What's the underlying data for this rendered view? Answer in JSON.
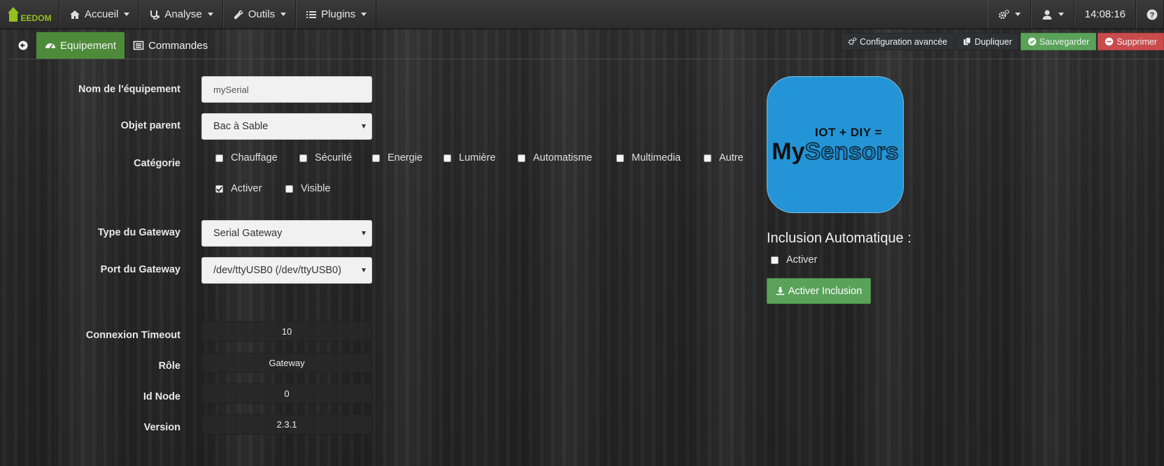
{
  "brand": {
    "text": "EEDOM"
  },
  "nav": {
    "items": [
      {
        "label": "Accueil",
        "icon": "home-icon"
      },
      {
        "label": "Analyse",
        "icon": "stethoscope-icon"
      },
      {
        "label": "Outils",
        "icon": "wrench-icon"
      },
      {
        "label": "Plugins",
        "icon": "list-icon"
      }
    ],
    "right": {
      "clock": "14:08:16"
    }
  },
  "tabs": {
    "equipement": "Equipement",
    "commandes": "Commandes"
  },
  "actions": {
    "config": "Configuration avancée",
    "duplicate": "Dupliquer",
    "save": "Sauvegarder",
    "delete": "Supprimer"
  },
  "form": {
    "name_label": "Nom de l'équipement",
    "name_value": "mySerial",
    "parent_label": "Objet parent",
    "parent_value": "Bac à Sable",
    "category_label": "Catégorie",
    "categories": [
      "Chauffage",
      "Sécurité",
      "Energie",
      "Lumière",
      "Automatisme",
      "Multimedia",
      "Autre"
    ],
    "activate_label": "Activer",
    "visible_label": "Visible",
    "gateway_type_label": "Type du Gateway",
    "gateway_type_value": "Serial Gateway",
    "gateway_port_label": "Port du Gateway",
    "gateway_port_value": "/dev/ttyUSB0 (/dev/ttyUSB0)",
    "timeout_label": "Connexion Timeout",
    "timeout_value": "10",
    "role_label": "Rôle",
    "role_value": "Gateway",
    "node_label": "Id Node",
    "node_value": "0",
    "version_label": "Version",
    "version_value": "2.3.1"
  },
  "plugin": {
    "logo_top": "IOT + DIY =",
    "logo_my": "My",
    "logo_sensors": "Sensors",
    "inclusion_title": "Inclusion Automatique :",
    "inclusion_checkbox": "Activer",
    "inclusion_button": "Activer Inclusion"
  },
  "colors": {
    "accent_green": "#4d8b3a",
    "save_green": "#5aa25a",
    "delete_red": "#c94c4c",
    "logo_blue": "#2395d6",
    "brand_green": "#94c11f"
  }
}
